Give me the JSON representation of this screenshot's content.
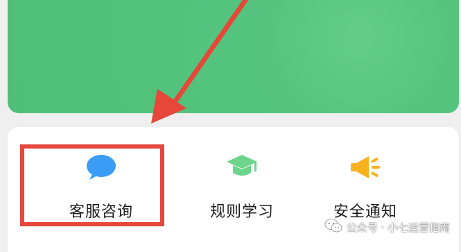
{
  "actions": [
    {
      "label": "客服咨询",
      "icon": "chat-bubble-icon",
      "color": "#3a9cf4"
    },
    {
      "label": "规则学习",
      "icon": "graduation-cap-icon",
      "color": "#6cd48b"
    },
    {
      "label": "安全通知",
      "icon": "megaphone-icon",
      "color": "#f7b21e"
    }
  ],
  "colors": {
    "banner": "#52c27b",
    "highlight": "#e5473a",
    "arrow": "#e5473a"
  },
  "watermark": "公众号 · 小七运营指南"
}
